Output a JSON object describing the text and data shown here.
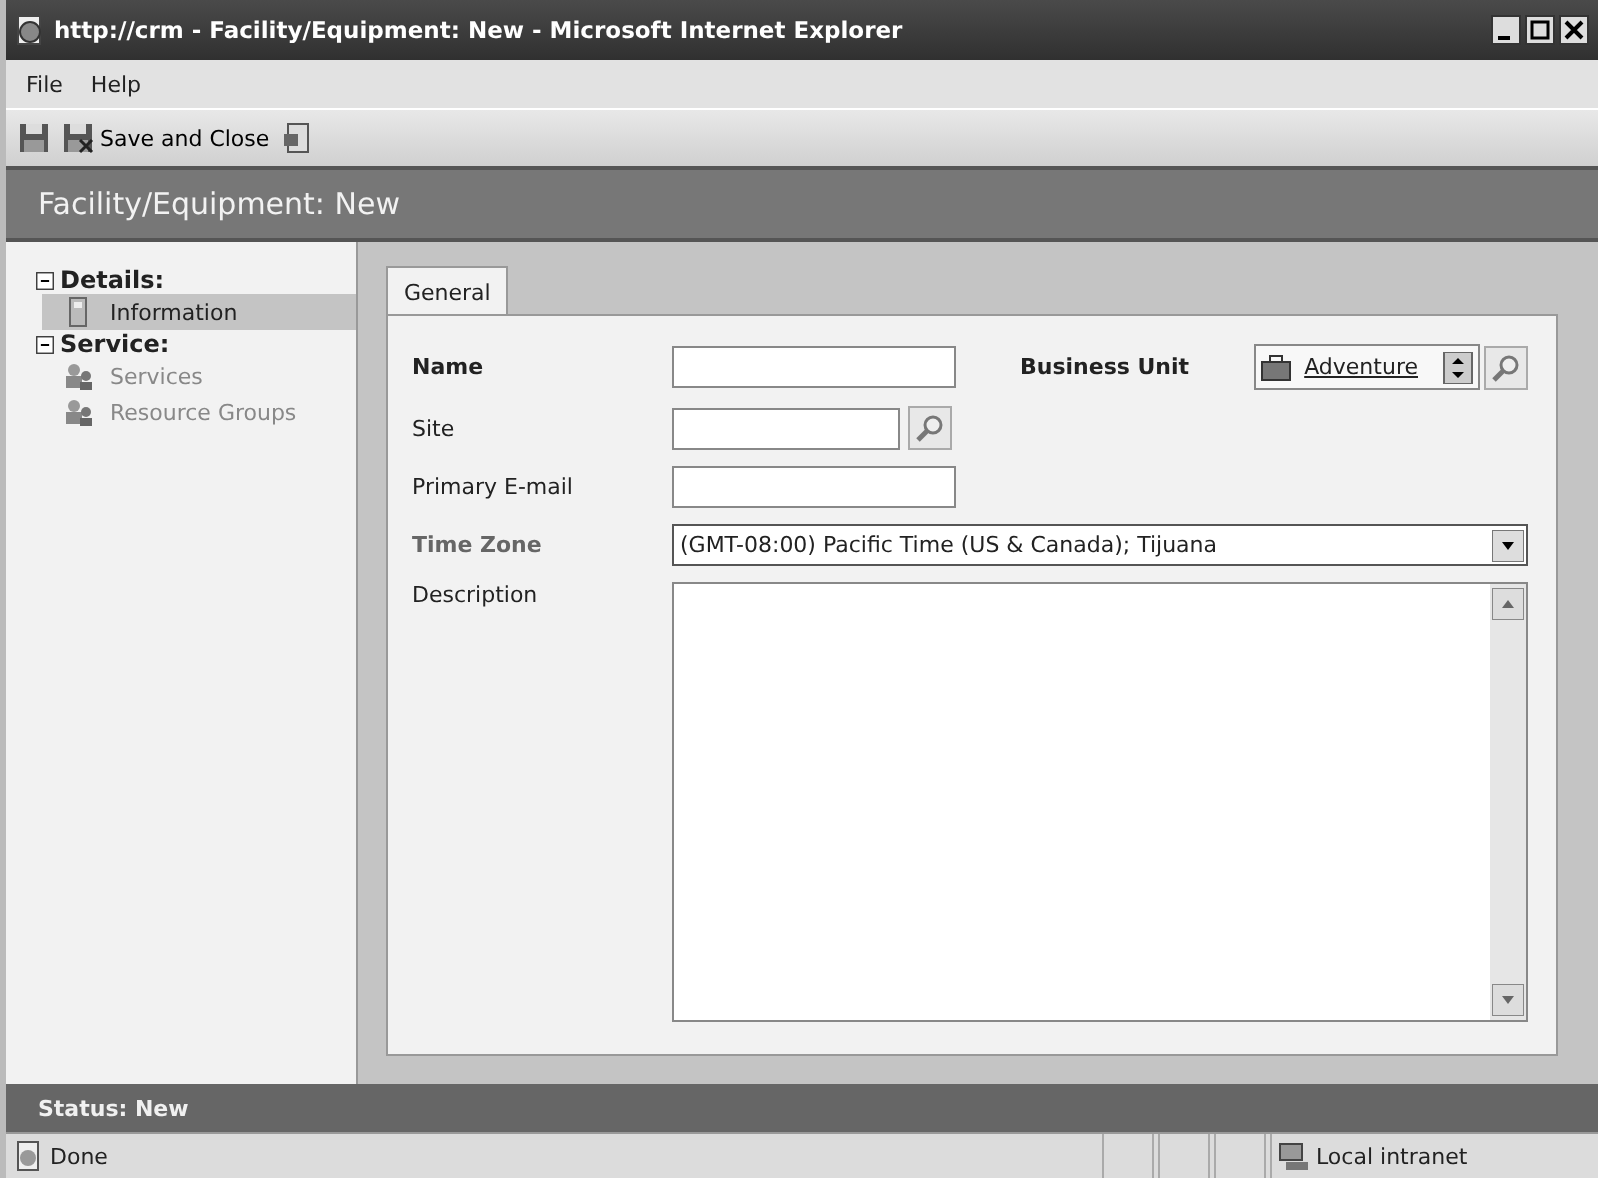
{
  "window": {
    "title": "http://crm - Facility/Equipment: New - Microsoft Internet Explorer"
  },
  "menu": [
    "File",
    "Help"
  ],
  "toolbar": {
    "save_and_close": "Save and Close"
  },
  "header": {
    "title": "Facility/Equipment: New"
  },
  "sidebar": {
    "sections": [
      {
        "label": "Details:",
        "expanded": true,
        "items": [
          {
            "label": "Information",
            "selected": true,
            "disabled": false
          }
        ]
      },
      {
        "label": "Service:",
        "expanded": true,
        "items": [
          {
            "label": "Services",
            "selected": false,
            "disabled": true
          },
          {
            "label": "Resource Groups",
            "selected": false,
            "disabled": true
          }
        ]
      }
    ]
  },
  "tabs": [
    {
      "label": "General",
      "selected": true
    }
  ],
  "form": {
    "name": {
      "label": "Name",
      "required": true
    },
    "business_unit": {
      "label": "Business Unit",
      "required": true,
      "value": "Adventure"
    },
    "site": {
      "label": "Site",
      "required": false
    },
    "primary_email": {
      "label": "Primary E-mail",
      "required": false
    },
    "time_zone": {
      "label": "Time Zone",
      "required": true,
      "value": "(GMT-08:00) Pacific Time (US & Canada); Tijuana"
    },
    "description": {
      "label": "Description",
      "required": false
    }
  },
  "form_status": "Status: New",
  "status_bar": {
    "text": "Done",
    "zone": "Local intranet"
  }
}
